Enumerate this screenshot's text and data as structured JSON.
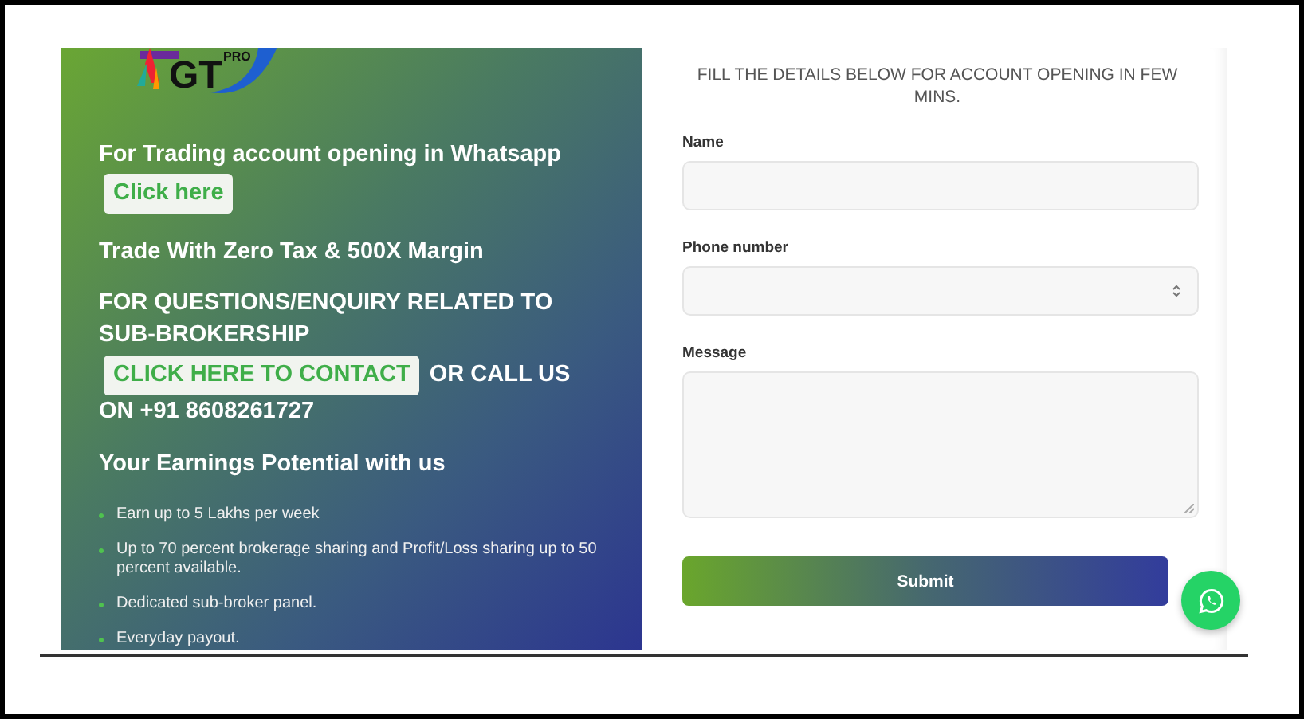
{
  "logo": {
    "mark": "GT",
    "badge": "PRO"
  },
  "promo": {
    "whatsapp_text": "For Trading account opening in Whatsapp",
    "whatsapp_button": "Click here",
    "tagline": "Trade With Zero Tax & 500X Margin",
    "enquiry_text": "FOR QUESTIONS/ENQUIRY RELATED TO SUB-BROKERSHIP",
    "contact_button": "CLICK HERE TO CONTACT",
    "call_text": "OR CALL US",
    "phone_text": "ON +91 8608261727",
    "earnings_heading": "Your Earnings Potential with us",
    "benefits": [
      "Earn up to 5 Lakhs per week",
      "Up to 70 percent brokerage sharing and Profit/Loss sharing up to 50 percent available.",
      "Dedicated sub-broker panel.",
      "Everyday payout."
    ]
  },
  "form": {
    "heading": "FILL THE DETAILS BELOW FOR ACCOUNT OPENING IN FEW MINS.",
    "fields": [
      {
        "label": "Name",
        "kind": "text"
      },
      {
        "label": "Phone number",
        "kind": "number"
      },
      {
        "label": "Message",
        "kind": "textarea"
      }
    ],
    "submit": "Submit"
  }
}
